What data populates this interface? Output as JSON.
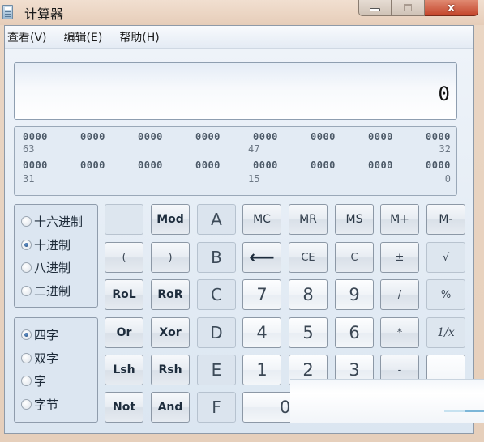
{
  "window": {
    "title": "计算器",
    "icon": "calculator-icon",
    "controls": {
      "minimize": "minimize-icon",
      "maximize": "maximize-icon",
      "close": "close-icon",
      "close_glyph": "x"
    }
  },
  "menu": [
    {
      "label": "查看(V)"
    },
    {
      "label": "编辑(E)"
    },
    {
      "label": "帮助(H)"
    }
  ],
  "display": {
    "value": "0"
  },
  "bit_display": {
    "row1": [
      "0000",
      "0000",
      "0000",
      "0000",
      "0000",
      "0000",
      "0000",
      "0000"
    ],
    "row1_indices": {
      "left": "63",
      "mid": "47",
      "right": "32"
    },
    "row2": [
      "0000",
      "0000",
      "0000",
      "0000",
      "0000",
      "0000",
      "0000",
      "0000"
    ],
    "row2_indices": {
      "left": "31",
      "mid": "15",
      "right": "0"
    }
  },
  "radix": {
    "options": [
      {
        "label": "十六进制",
        "checked": false
      },
      {
        "label": "十进制",
        "checked": true
      },
      {
        "label": "八进制",
        "checked": false
      },
      {
        "label": "二进制",
        "checked": false
      }
    ]
  },
  "word_size": {
    "options": [
      {
        "label": "四字",
        "checked": true
      },
      {
        "label": "双字",
        "checked": false
      },
      {
        "label": "字",
        "checked": false
      },
      {
        "label": "字节",
        "checked": false
      }
    ]
  },
  "keys": {
    "blank": "",
    "mod": "Mod",
    "lparen": "(",
    "rparen": ")",
    "rol": "RoL",
    "ror": "RoR",
    "or": "Or",
    "xor": "Xor",
    "lsh": "Lsh",
    "rsh": "Rsh",
    "not": "Not",
    "and": "And",
    "hex_a": "A",
    "hex_b": "B",
    "hex_c": "C",
    "hex_d": "D",
    "hex_e": "E",
    "hex_f": "F",
    "mc": "MC",
    "mr": "MR",
    "ms": "MS",
    "mplus": "M+",
    "mminus": "M-",
    "backspace": "⟵",
    "ce": "CE",
    "c": "C",
    "plusminus": "±",
    "sqrt": "√",
    "d7": "7",
    "d8": "8",
    "d9": "9",
    "div": "/",
    "percent": "%",
    "d4": "4",
    "d5": "5",
    "d6": "6",
    "mul": "*",
    "recip": "1/x",
    "d1": "1",
    "d2": "2",
    "d3": "3",
    "sub": "-",
    "d0": "0"
  }
}
